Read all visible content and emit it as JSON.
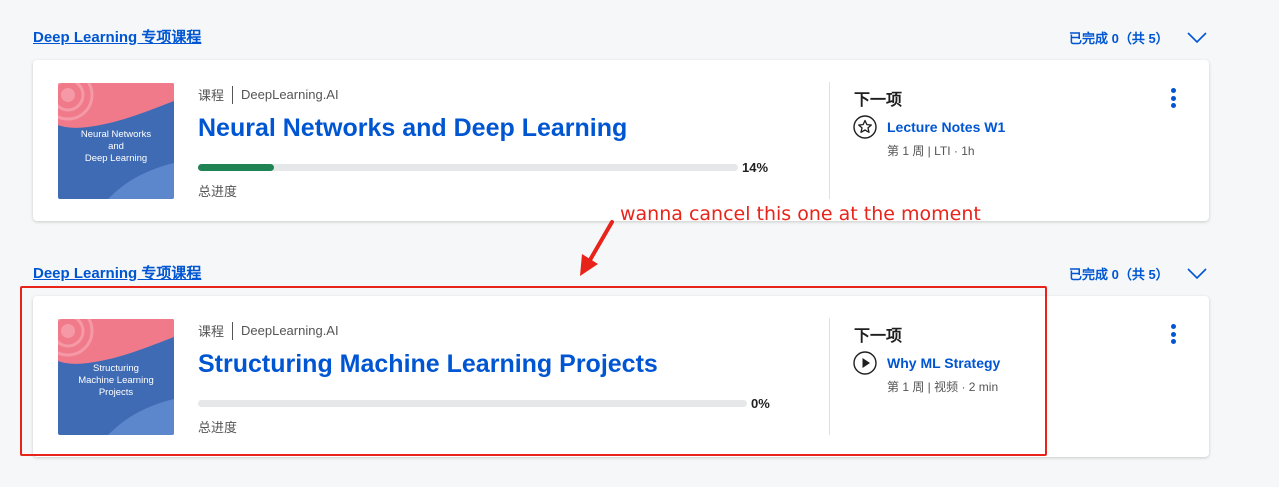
{
  "sections": [
    {
      "series_link": "Deep Learning 专项课程",
      "completion": "已完成 0（共 5）",
      "card": {
        "type_label": "课程",
        "partner": "DeepLearning.AI",
        "title": "Neural Networks and Deep Learning",
        "thumb_lines": [
          "Neural Networks",
          "and",
          "Deep Learning"
        ],
        "progress": 0.14,
        "progress_text": "14%",
        "progress_label": "总进度",
        "next_heading": "下一项",
        "next_icon": "star-icon",
        "next_item": "Lecture Notes W1",
        "next_meta": "第 1 周 | LTI · 1h"
      }
    },
    {
      "series_link": "Deep Learning 专项课程",
      "completion": "已完成 0（共 5）",
      "card": {
        "type_label": "课程",
        "partner": "DeepLearning.AI",
        "title": "Structuring Machine Learning Projects",
        "thumb_lines": [
          "Structuring",
          "Machine Learning",
          "Projects"
        ],
        "progress": 0.0,
        "progress_text": "0%",
        "progress_label": "总进度",
        "next_heading": "下一项",
        "next_icon": "play-icon",
        "next_item": "Why ML Strategy",
        "next_meta": "第 1 周 | 视频 · 2 min"
      }
    }
  ],
  "annotation": {
    "text": "wanna cancel this one at the moment",
    "color": "#e8231a"
  },
  "colors": {
    "link": "#0056d2",
    "progress_fill": "#1f8354",
    "thumb_blue": "#3f6bb5",
    "thumb_pink": "#f07a8a"
  }
}
